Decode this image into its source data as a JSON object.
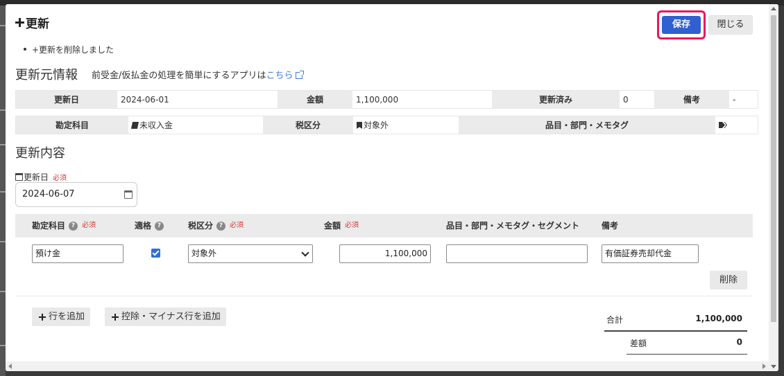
{
  "dialog": {
    "title": "更新",
    "save_label": "保存",
    "close_label": "閉じる",
    "notice": "+更新を削除しました"
  },
  "source_info": {
    "heading": "更新元情報",
    "description": "前受金/仮払金の処理を簡単にするアプリは",
    "link_text": "こちら",
    "row1": {
      "date_label": "更新日",
      "date_value": "2024-06-01",
      "amount_label": "金額",
      "amount_value": "1,100,000",
      "updated_label": "更新済み",
      "updated_value": "0",
      "note_label": "備考",
      "note_value": "-"
    },
    "row2": {
      "account_label": "勘定科目",
      "account_value": "未収入金",
      "tax_label": "税区分",
      "tax_value": "対象外",
      "items_label": "品目・部門・メモタグ"
    }
  },
  "update_content": {
    "heading": "更新内容",
    "date_label": "更新日",
    "required": "必須",
    "date_value": "2024-06-07"
  },
  "table": {
    "headers": {
      "account": "勘定科目",
      "eligible": "適格",
      "tax": "税区分",
      "amount": "金額",
      "items": "品目・部門・メモタグ・セグメント",
      "note": "備考"
    },
    "help_glyph": "?",
    "row": {
      "account": "預け金",
      "eligible_checked": true,
      "tax": "対象外",
      "amount": "1,100,000",
      "items": "",
      "note": "有価証券売却代金"
    },
    "delete_label": "削除"
  },
  "actions": {
    "add_row": "行を追加",
    "add_minus_row": "控除・マイナス行を追加"
  },
  "totals": {
    "total_label": "合計",
    "total_value": "1,100,000",
    "diff_label": "差額",
    "diff_value": "0"
  },
  "colors": {
    "primary": "#2f5fd0",
    "highlight": "#e8175d",
    "required": "#d53a3a",
    "link": "#3e7bd9"
  }
}
